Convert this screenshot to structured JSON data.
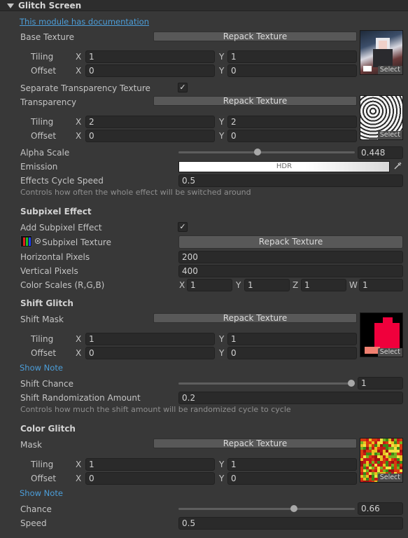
{
  "header": {
    "title": "Glitch Screen"
  },
  "doc_link": "This module has documentation",
  "base_texture": {
    "label": "Base Texture",
    "button": "Repack Texture",
    "tiling_label": "Tiling",
    "offset_label": "Offset",
    "x_label": "X",
    "y_label": "Y",
    "tiling_x": "1",
    "tiling_y": "1",
    "offset_x": "0",
    "offset_y": "0",
    "select": "Select"
  },
  "separate_transparency": {
    "label": "Separate Transparency Texture",
    "checked": "✓"
  },
  "transparency": {
    "label": "Transparency",
    "button": "Repack Texture",
    "tiling_label": "Tiling",
    "offset_label": "Offset",
    "x_label": "X",
    "y_label": "Y",
    "tiling_x": "2",
    "tiling_y": "2",
    "offset_x": "0",
    "offset_y": "0",
    "select": "Select"
  },
  "alpha_scale": {
    "label": "Alpha Scale",
    "value": "0.448",
    "fraction": 0.448
  },
  "emission": {
    "label": "Emission",
    "hdr": "HDR"
  },
  "effects_cycle": {
    "label": "Effects Cycle Speed",
    "value": "0.5",
    "help": "Controls how often the whole effect will be switched around"
  },
  "subpixel": {
    "section": "Subpixel Effect",
    "add_label": "Add Subpixel Effect",
    "add_checked": "✓",
    "texture_label": "Subpixel Texture",
    "button": "Repack Texture",
    "horizontal_label": "Horizontal Pixels",
    "horizontal": "200",
    "vertical_label": "Vertical Pixels",
    "vertical": "400",
    "scales_label": "Color Scales (R,G,B)",
    "scales": [
      {
        "axis": "X",
        "value": "1"
      },
      {
        "axis": "Y",
        "value": "1"
      },
      {
        "axis": "Z",
        "value": "1"
      },
      {
        "axis": "W",
        "value": "1"
      }
    ]
  },
  "shift": {
    "section": "Shift Glitch",
    "mask_label": "Shift Mask",
    "button": "Repack Texture",
    "tiling_label": "Tiling",
    "offset_label": "Offset",
    "x_label": "X",
    "y_label": "Y",
    "tiling_x": "1",
    "tiling_y": "1",
    "offset_x": "0",
    "offset_y": "0",
    "select": "Select",
    "show_note": "Show Note",
    "chance_label": "Shift Chance",
    "chance": "1",
    "chance_fraction": 1.0,
    "random_label": "Shift Randomization Amount",
    "random": "0.2",
    "help": "Controls how much the shift amount will be randomized cycle to cycle"
  },
  "color": {
    "section": "Color Glitch",
    "mask_label": "Mask",
    "button": "Repack Texture",
    "tiling_label": "Tiling",
    "offset_label": "Offset",
    "x_label": "X",
    "y_label": "Y",
    "tiling_x": "1",
    "tiling_y": "1",
    "offset_x": "0",
    "offset_y": "0",
    "select": "Select",
    "show_note": "Show Note",
    "chance_label": "Chance",
    "chance": "0.66",
    "chance_fraction": 0.66,
    "speed_label": "Speed",
    "speed": "0.5"
  }
}
